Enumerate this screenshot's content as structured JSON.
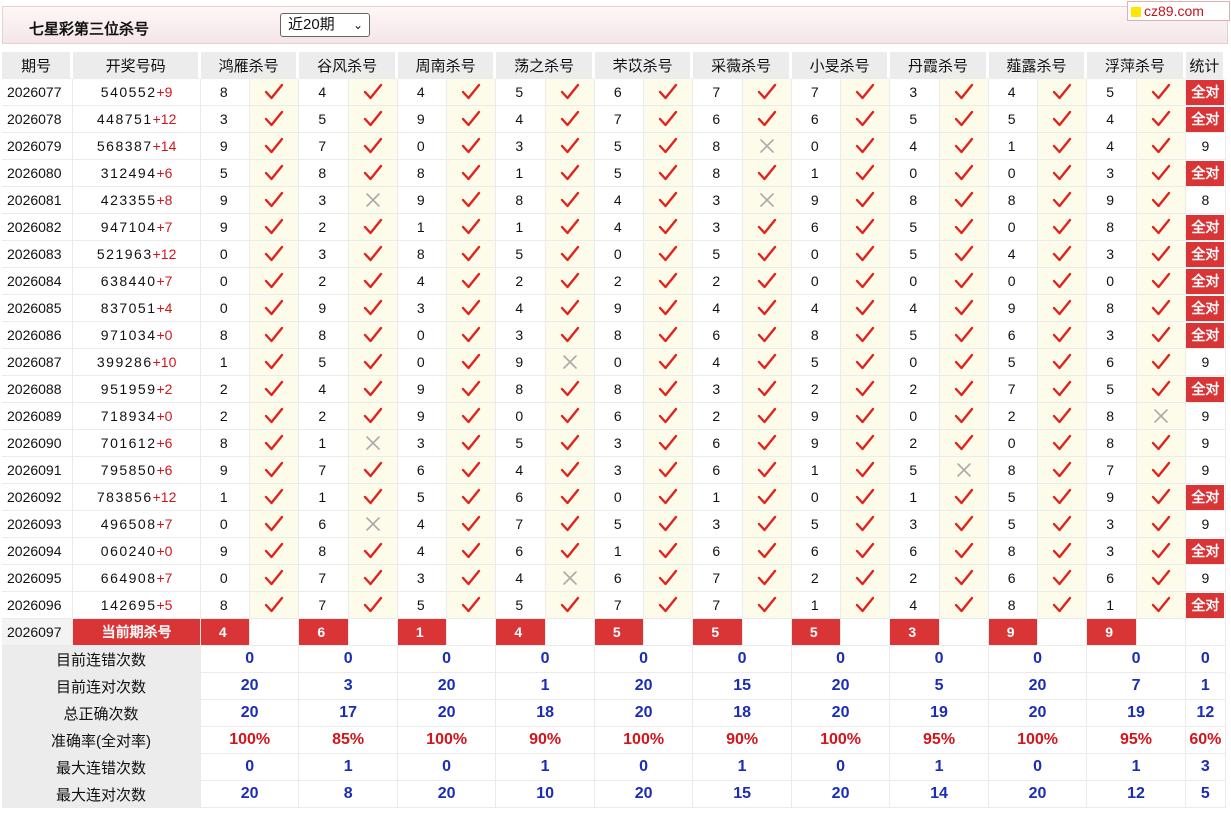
{
  "header": {
    "title": "七星彩第三位杀号",
    "range_select": "近20期",
    "logo": "cz89.com",
    "colors": {
      "accent_red": "#d93436",
      "stat_blue": "#1a2db5",
      "bar_pink": "#f4e6e8"
    }
  },
  "columns": {
    "issue": "期号",
    "draw": "开奖号码",
    "experts": [
      "鸿雁杀号",
      "谷风杀号",
      "周南杀号",
      "荡之杀号",
      "芣苡杀号",
      "采薇杀号",
      "小旻杀号",
      "丹霞杀号",
      "薤露杀号",
      "浮萍杀号"
    ],
    "stat": "统计"
  },
  "rows": [
    {
      "issue": "2026077",
      "digits": "540552",
      "extra": "+9",
      "picks": [
        [
          8,
          1
        ],
        [
          4,
          1
        ],
        [
          4,
          1
        ],
        [
          5,
          1
        ],
        [
          6,
          1
        ],
        [
          7,
          1
        ],
        [
          7,
          1
        ],
        [
          3,
          1
        ],
        [
          4,
          1
        ],
        [
          5,
          1
        ]
      ],
      "stat": "全对"
    },
    {
      "issue": "2026078",
      "digits": "448751",
      "extra": "+12",
      "picks": [
        [
          3,
          1
        ],
        [
          5,
          1
        ],
        [
          9,
          1
        ],
        [
          4,
          1
        ],
        [
          7,
          1
        ],
        [
          6,
          1
        ],
        [
          6,
          1
        ],
        [
          5,
          1
        ],
        [
          5,
          1
        ],
        [
          4,
          1
        ]
      ],
      "stat": "全对"
    },
    {
      "issue": "2026079",
      "digits": "568387",
      "extra": "+14",
      "picks": [
        [
          9,
          1
        ],
        [
          7,
          1
        ],
        [
          0,
          1
        ],
        [
          3,
          1
        ],
        [
          5,
          1
        ],
        [
          8,
          0
        ],
        [
          0,
          1
        ],
        [
          4,
          1
        ],
        [
          1,
          1
        ],
        [
          4,
          1
        ]
      ],
      "stat": "9"
    },
    {
      "issue": "2026080",
      "digits": "312494",
      "extra": "+6",
      "picks": [
        [
          5,
          1
        ],
        [
          8,
          1
        ],
        [
          8,
          1
        ],
        [
          1,
          1
        ],
        [
          5,
          1
        ],
        [
          8,
          1
        ],
        [
          1,
          1
        ],
        [
          0,
          1
        ],
        [
          0,
          1
        ],
        [
          3,
          1
        ]
      ],
      "stat": "全对"
    },
    {
      "issue": "2026081",
      "digits": "423355",
      "extra": "+8",
      "picks": [
        [
          9,
          1
        ],
        [
          3,
          0
        ],
        [
          9,
          1
        ],
        [
          8,
          1
        ],
        [
          4,
          1
        ],
        [
          3,
          0
        ],
        [
          9,
          1
        ],
        [
          8,
          1
        ],
        [
          8,
          1
        ],
        [
          9,
          1
        ]
      ],
      "stat": "8"
    },
    {
      "issue": "2026082",
      "digits": "947104",
      "extra": "+7",
      "picks": [
        [
          9,
          1
        ],
        [
          2,
          1
        ],
        [
          1,
          1
        ],
        [
          1,
          1
        ],
        [
          4,
          1
        ],
        [
          3,
          1
        ],
        [
          6,
          1
        ],
        [
          5,
          1
        ],
        [
          0,
          1
        ],
        [
          8,
          1
        ]
      ],
      "stat": "全对"
    },
    {
      "issue": "2026083",
      "digits": "521963",
      "extra": "+12",
      "picks": [
        [
          0,
          1
        ],
        [
          3,
          1
        ],
        [
          8,
          1
        ],
        [
          5,
          1
        ],
        [
          0,
          1
        ],
        [
          5,
          1
        ],
        [
          0,
          1
        ],
        [
          5,
          1
        ],
        [
          4,
          1
        ],
        [
          3,
          1
        ]
      ],
      "stat": "全对"
    },
    {
      "issue": "2026084",
      "digits": "638440",
      "extra": "+7",
      "picks": [
        [
          0,
          1
        ],
        [
          2,
          1
        ],
        [
          4,
          1
        ],
        [
          2,
          1
        ],
        [
          2,
          1
        ],
        [
          2,
          1
        ],
        [
          0,
          1
        ],
        [
          0,
          1
        ],
        [
          0,
          1
        ],
        [
          0,
          1
        ]
      ],
      "stat": "全对"
    },
    {
      "issue": "2026085",
      "digits": "837051",
      "extra": "+4",
      "picks": [
        [
          0,
          1
        ],
        [
          9,
          1
        ],
        [
          3,
          1
        ],
        [
          4,
          1
        ],
        [
          9,
          1
        ],
        [
          4,
          1
        ],
        [
          4,
          1
        ],
        [
          4,
          1
        ],
        [
          9,
          1
        ],
        [
          8,
          1
        ]
      ],
      "stat": "全对"
    },
    {
      "issue": "2026086",
      "digits": "971034",
      "extra": "+0",
      "picks": [
        [
          8,
          1
        ],
        [
          8,
          1
        ],
        [
          0,
          1
        ],
        [
          3,
          1
        ],
        [
          8,
          1
        ],
        [
          6,
          1
        ],
        [
          8,
          1
        ],
        [
          5,
          1
        ],
        [
          6,
          1
        ],
        [
          3,
          1
        ]
      ],
      "stat": "全对"
    },
    {
      "issue": "2026087",
      "digits": "399286",
      "extra": "+10",
      "picks": [
        [
          1,
          1
        ],
        [
          5,
          1
        ],
        [
          0,
          1
        ],
        [
          9,
          0
        ],
        [
          0,
          1
        ],
        [
          4,
          1
        ],
        [
          5,
          1
        ],
        [
          0,
          1
        ],
        [
          5,
          1
        ],
        [
          6,
          1
        ]
      ],
      "stat": "9"
    },
    {
      "issue": "2026088",
      "digits": "951959",
      "extra": "+2",
      "picks": [
        [
          2,
          1
        ],
        [
          4,
          1
        ],
        [
          9,
          1
        ],
        [
          8,
          1
        ],
        [
          8,
          1
        ],
        [
          3,
          1
        ],
        [
          2,
          1
        ],
        [
          2,
          1
        ],
        [
          7,
          1
        ],
        [
          5,
          1
        ]
      ],
      "stat": "全对"
    },
    {
      "issue": "2026089",
      "digits": "718934",
      "extra": "+0",
      "picks": [
        [
          2,
          1
        ],
        [
          2,
          1
        ],
        [
          9,
          1
        ],
        [
          0,
          1
        ],
        [
          6,
          1
        ],
        [
          2,
          1
        ],
        [
          9,
          1
        ],
        [
          0,
          1
        ],
        [
          2,
          1
        ],
        [
          8,
          0
        ]
      ],
      "stat": "9"
    },
    {
      "issue": "2026090",
      "digits": "701612",
      "extra": "+6",
      "picks": [
        [
          8,
          1
        ],
        [
          1,
          0
        ],
        [
          3,
          1
        ],
        [
          5,
          1
        ],
        [
          3,
          1
        ],
        [
          6,
          1
        ],
        [
          9,
          1
        ],
        [
          2,
          1
        ],
        [
          0,
          1
        ],
        [
          8,
          1
        ]
      ],
      "stat": "9"
    },
    {
      "issue": "2026091",
      "digits": "795850",
      "extra": "+6",
      "picks": [
        [
          9,
          1
        ],
        [
          7,
          1
        ],
        [
          6,
          1
        ],
        [
          4,
          1
        ],
        [
          3,
          1
        ],
        [
          6,
          1
        ],
        [
          1,
          1
        ],
        [
          5,
          0
        ],
        [
          8,
          1
        ],
        [
          7,
          1
        ]
      ],
      "stat": "9"
    },
    {
      "issue": "2026092",
      "digits": "783856",
      "extra": "+12",
      "picks": [
        [
          1,
          1
        ],
        [
          1,
          1
        ],
        [
          5,
          1
        ],
        [
          6,
          1
        ],
        [
          0,
          1
        ],
        [
          1,
          1
        ],
        [
          0,
          1
        ],
        [
          1,
          1
        ],
        [
          5,
          1
        ],
        [
          9,
          1
        ]
      ],
      "stat": "全对"
    },
    {
      "issue": "2026093",
      "digits": "496508",
      "extra": "+7",
      "picks": [
        [
          0,
          1
        ],
        [
          6,
          0
        ],
        [
          4,
          1
        ],
        [
          7,
          1
        ],
        [
          5,
          1
        ],
        [
          3,
          1
        ],
        [
          5,
          1
        ],
        [
          3,
          1
        ],
        [
          5,
          1
        ],
        [
          3,
          1
        ]
      ],
      "stat": "9"
    },
    {
      "issue": "2026094",
      "digits": "060240",
      "extra": "+0",
      "picks": [
        [
          9,
          1
        ],
        [
          8,
          1
        ],
        [
          4,
          1
        ],
        [
          6,
          1
        ],
        [
          1,
          1
        ],
        [
          6,
          1
        ],
        [
          6,
          1
        ],
        [
          6,
          1
        ],
        [
          8,
          1
        ],
        [
          3,
          1
        ]
      ],
      "stat": "全对"
    },
    {
      "issue": "2026095",
      "digits": "664908",
      "extra": "+7",
      "picks": [
        [
          0,
          1
        ],
        [
          7,
          1
        ],
        [
          3,
          1
        ],
        [
          4,
          0
        ],
        [
          6,
          1
        ],
        [
          7,
          1
        ],
        [
          2,
          1
        ],
        [
          2,
          1
        ],
        [
          6,
          1
        ],
        [
          6,
          1
        ]
      ],
      "stat": "9"
    },
    {
      "issue": "2026096",
      "digits": "142695",
      "extra": "+5",
      "picks": [
        [
          8,
          1
        ],
        [
          7,
          1
        ],
        [
          5,
          1
        ],
        [
          5,
          1
        ],
        [
          7,
          1
        ],
        [
          7,
          1
        ],
        [
          1,
          1
        ],
        [
          4,
          1
        ],
        [
          8,
          1
        ],
        [
          1,
          1
        ]
      ],
      "stat": "全对"
    }
  ],
  "current": {
    "issue": "2026097",
    "label": "当前期杀号",
    "picks": [
      "4",
      "6",
      "1",
      "4",
      "5",
      "5",
      "5",
      "3",
      "9",
      "9"
    ]
  },
  "summary": [
    {
      "label": "目前连错次数",
      "values": [
        "0",
        "0",
        "0",
        "0",
        "0",
        "0",
        "0",
        "0",
        "0",
        "0"
      ],
      "stat": "0",
      "style": "blue"
    },
    {
      "label": "目前连对次数",
      "values": [
        "20",
        "3",
        "20",
        "1",
        "20",
        "15",
        "20",
        "5",
        "20",
        "7"
      ],
      "stat": "1",
      "style": "blue"
    },
    {
      "label": "总正确次数",
      "values": [
        "20",
        "17",
        "20",
        "18",
        "20",
        "18",
        "20",
        "19",
        "20",
        "19"
      ],
      "stat": "12",
      "style": "blue"
    },
    {
      "label": "准确率(全对率)",
      "values": [
        "100%",
        "85%",
        "100%",
        "90%",
        "100%",
        "90%",
        "100%",
        "95%",
        "100%",
        "95%"
      ],
      "stat": "60%",
      "style": "red"
    },
    {
      "label": "最大连错次数",
      "values": [
        "0",
        "1",
        "0",
        "1",
        "0",
        "1",
        "0",
        "1",
        "0",
        "1"
      ],
      "stat": "3",
      "style": "blue"
    },
    {
      "label": "最大连对次数",
      "values": [
        "20",
        "8",
        "20",
        "10",
        "20",
        "15",
        "20",
        "14",
        "20",
        "12"
      ],
      "stat": "5",
      "style": "blue"
    }
  ]
}
